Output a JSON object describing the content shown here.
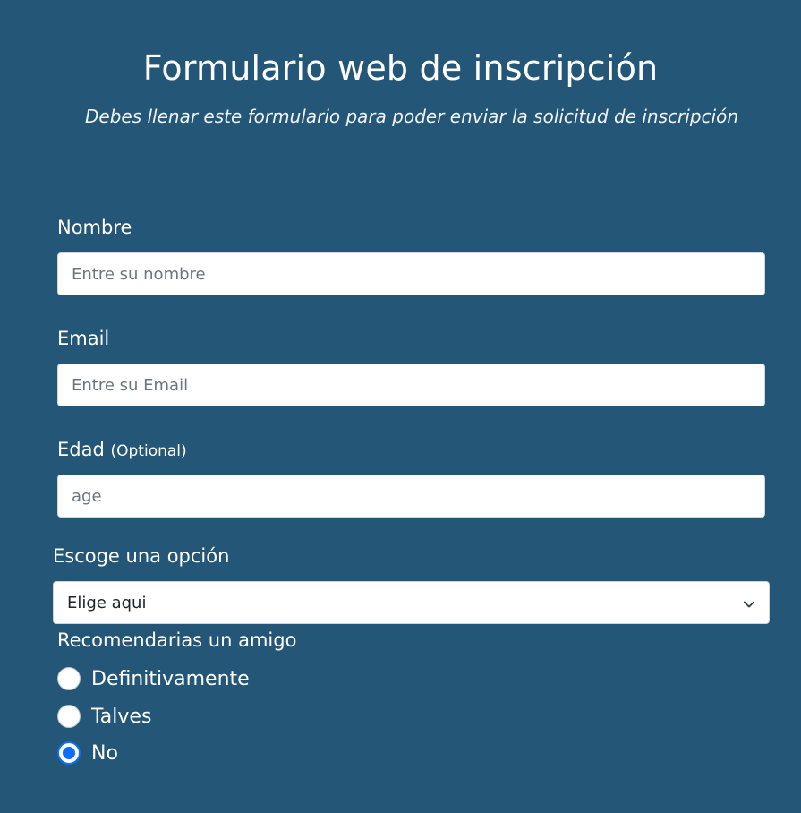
{
  "header": {
    "title": "Formulario web de inscripción",
    "subtitle": "Debes llenar este formulario para poder enviar la solicitud de inscripción"
  },
  "form": {
    "name": {
      "label": "Nombre",
      "placeholder": "Entre su nombre",
      "value": ""
    },
    "email": {
      "label": "Email",
      "placeholder": "Entre su Email",
      "value": ""
    },
    "age": {
      "label": "Edad",
      "optional": "(Optional)",
      "placeholder": "age",
      "value": ""
    },
    "option": {
      "label": "Escoge una opción",
      "selected": "Elige aqui"
    },
    "recommend": {
      "label": "Recomendarias un amigo",
      "options": [
        {
          "label": "Definitivamente",
          "checked": false
        },
        {
          "label": "Talves",
          "checked": false
        },
        {
          "label": "No",
          "checked": true
        }
      ]
    }
  },
  "colors": {
    "background": "#235677",
    "text": "#ffffff",
    "radio_accent": "#0d6efd"
  },
  "icons": {
    "select_arrow": "chevron-down-icon"
  }
}
